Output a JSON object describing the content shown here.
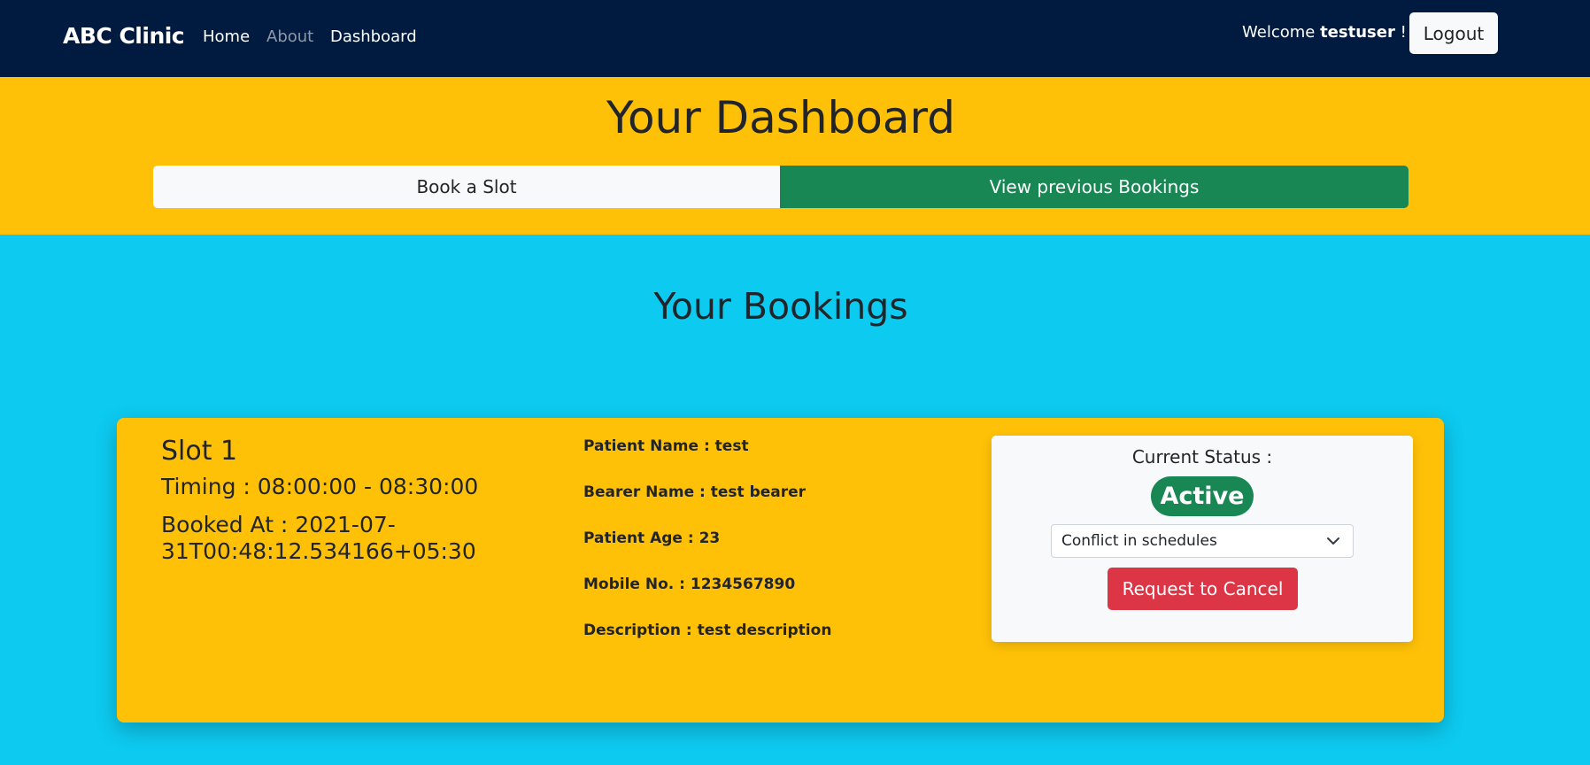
{
  "navbar": {
    "brand": "ABC Clinic",
    "links": [
      "Home",
      "About",
      "Dashboard"
    ],
    "welcome_prefix": "Welcome",
    "username": "testuser",
    "welcome_suffix": "!",
    "logout_label": "Logout"
  },
  "dashboard": {
    "title": "Your Dashboard",
    "tabs": [
      "Book a Slot",
      "View previous Bookings"
    ],
    "active_tab": "View previous Bookings"
  },
  "bookings": {
    "title": "Your Bookings",
    "items": [
      {
        "slot": "Slot 1",
        "timing": "Timing : 08:00:00 - 08:30:00",
        "booked_at": "Booked At : 2021-07-31T00:48:12.534166+05:30",
        "details": [
          "Patient Name : test",
          "Bearer Name : test bearer",
          "Patient Age : 23",
          "Mobile No. : 1234567890",
          "Description : test description"
        ],
        "status_label": "Current Status :",
        "status": "Active",
        "cancel_reason": "Conflict in schedules",
        "cancel_button": "Request to Cancel"
      }
    ]
  },
  "colors": {
    "navbar": "#001b3f",
    "warning": "#ffc107",
    "info": "#0dcaf0",
    "success": "#198754",
    "danger": "#dc3545",
    "light": "#f8f9fa"
  },
  "icons": {
    "select": "chevron-down-icon"
  }
}
